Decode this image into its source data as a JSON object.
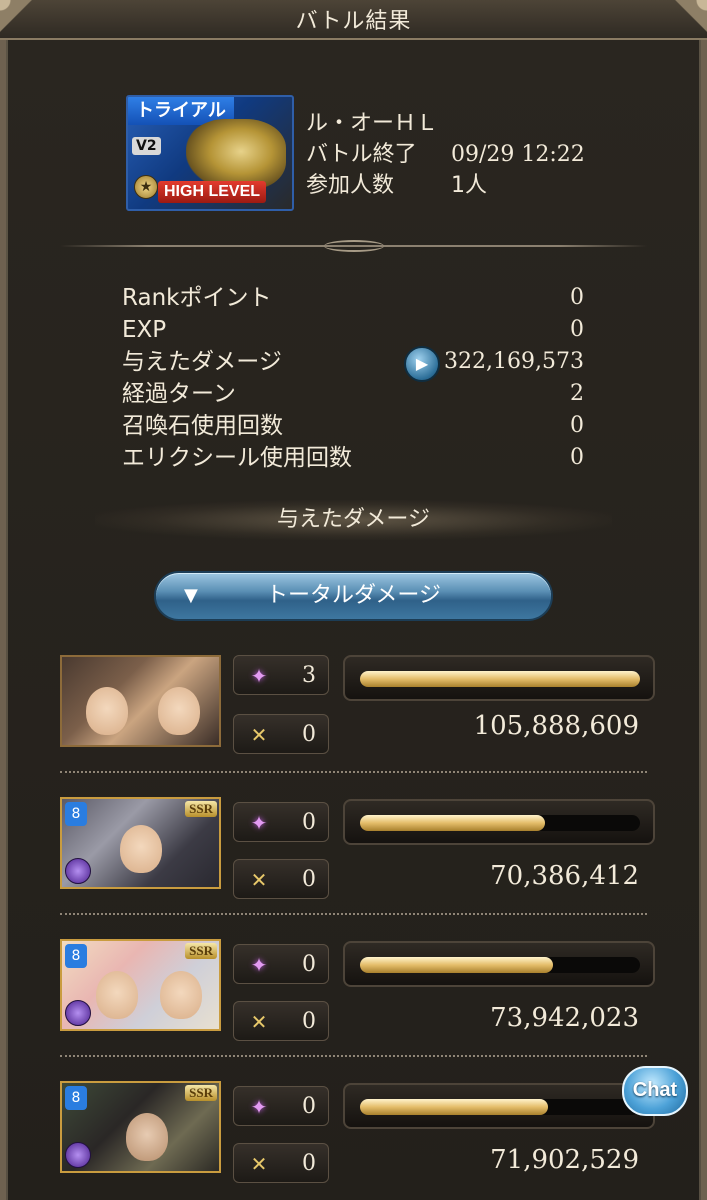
{
  "header": {
    "title": "バトル結果"
  },
  "quest": {
    "banner": {
      "trial_label": "トライアル",
      "version_label": "V2",
      "level_label": "HIGH LEVEL"
    },
    "name": "ル・オーＨＬ",
    "end_label": "バトル終了",
    "end_time": "09/29 12:22",
    "participants_label": "参加人数",
    "participants_value": "1人"
  },
  "stats": [
    {
      "label": "Rankポイント",
      "value": "0"
    },
    {
      "label": "EXP",
      "value": "0"
    },
    {
      "label": "与えたダメージ",
      "value": "322,169,573"
    },
    {
      "label": "経過ターン",
      "value": "2"
    },
    {
      "label": "召喚石使用回数",
      "value": "0"
    },
    {
      "label": "エリクシール使用回数",
      "value": "0"
    }
  ],
  "damage_section": {
    "heading": "与えたダメージ",
    "toggle_label": "トータルダメージ"
  },
  "characters": [
    {
      "ability_count": "3",
      "ougi_count": "0",
      "damage": "105,888,609",
      "bar_fraction": 1.0,
      "ssr": ""
    },
    {
      "ability_count": "0",
      "ougi_count": "0",
      "damage": "70,386,412",
      "bar_fraction": 0.66,
      "ssr": "SSR"
    },
    {
      "ability_count": "0",
      "ougi_count": "0",
      "damage": "73,942,023",
      "bar_fraction": 0.69,
      "ssr": "SSR"
    },
    {
      "ability_count": "0",
      "ougi_count": "0",
      "damage": "71,902,529",
      "bar_fraction": 0.67,
      "ssr": "SSR"
    }
  ],
  "chat": {
    "label": "Chat"
  },
  "colors": {
    "bar_gold": "#e4bd6a",
    "toggle_blue": "#5a8fb4",
    "frame": "#6e6150"
  },
  "icons": {
    "ability": "sparkle-icon",
    "ougi": "crossed-swords-icon",
    "play": "play-icon",
    "toggle": "triangle-down-icon"
  }
}
